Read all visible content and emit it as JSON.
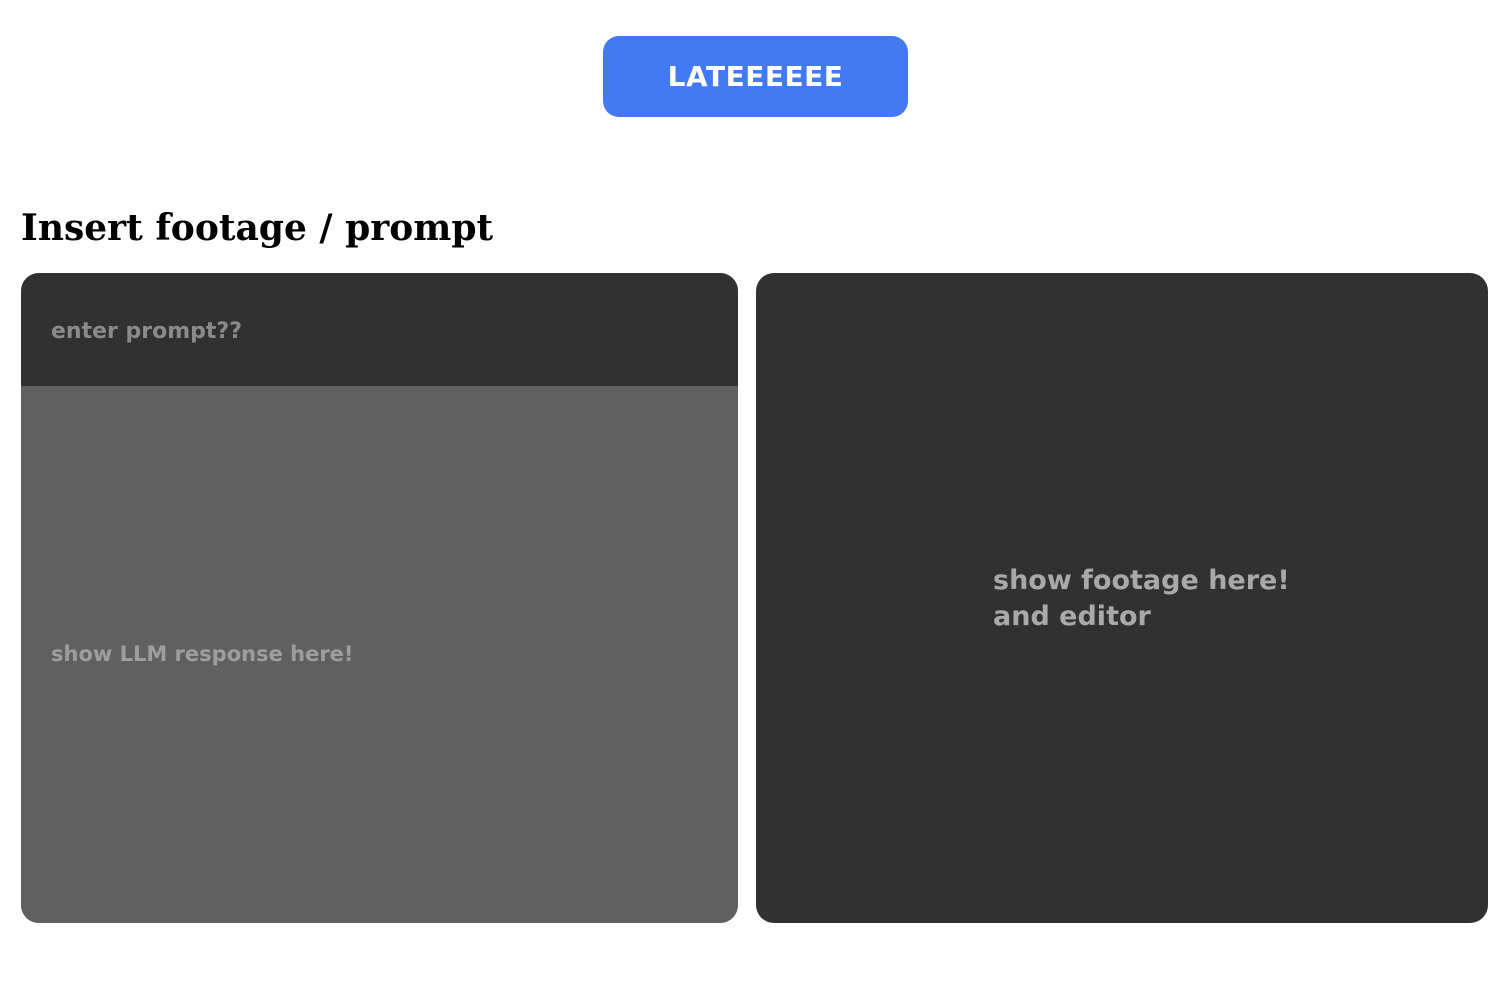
{
  "header": {
    "button_label": "LATEEEEEE"
  },
  "main": {
    "section_title": "Insert footage / prompt",
    "prompt": {
      "placeholder": "enter prompt??",
      "value": ""
    },
    "response": {
      "text": "show LLM response here!"
    },
    "footage": {
      "line1": "show footage here!",
      "line2": "and editor"
    }
  },
  "colors": {
    "accent": "#437af3",
    "panel_dark": "#313131",
    "panel_mid": "#606060",
    "background": "#ffffff"
  }
}
